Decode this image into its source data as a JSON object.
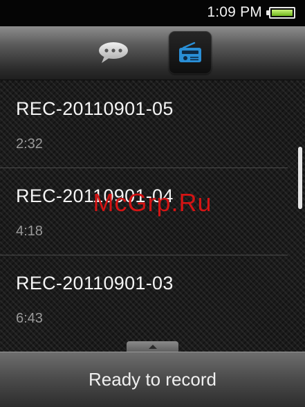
{
  "status_bar": {
    "time": "1:09 PM",
    "battery_icon": "battery-icon"
  },
  "tabs": [
    {
      "name": "messages",
      "icon": "speech-bubble-icon",
      "selected": false
    },
    {
      "name": "radio",
      "icon": "radio-icon",
      "selected": true
    }
  ],
  "recordings": [
    {
      "name": "REC-20110901-05",
      "duration": "2:32"
    },
    {
      "name": "REC-20110901-04",
      "duration": "4:18"
    },
    {
      "name": "REC-20110901-03",
      "duration": "6:43"
    }
  ],
  "watermark": "McGrp.Ru",
  "bottom": {
    "label": "Ready to record"
  },
  "colors": {
    "accent_blue": "#2a8fd6",
    "battery_green": "#8cd63a",
    "watermark_red": "#d41414"
  }
}
